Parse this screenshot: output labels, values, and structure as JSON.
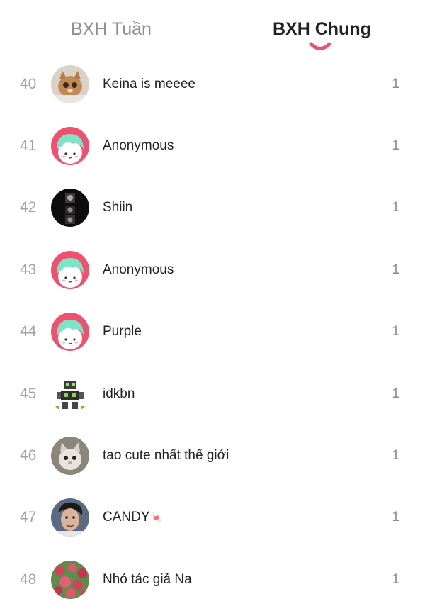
{
  "tabs": {
    "weekly": "BXH Tuần",
    "overall": "BXH Chung",
    "active": "overall"
  },
  "colors": {
    "accent": "#f0506e",
    "anon_bg": "#f0506e",
    "anon_hair": "#7de3c6"
  },
  "rows": [
    {
      "rank": "40",
      "name": "Keina is meeee",
      "score": "1",
      "avatar": "cat-photo"
    },
    {
      "rank": "41",
      "name": "Anonymous",
      "score": "1",
      "avatar": "anonymous-avatar"
    },
    {
      "rank": "42",
      "name": "Shiin",
      "score": "1",
      "avatar": "dark-photo"
    },
    {
      "rank": "43",
      "name": "Anonymous",
      "score": "1",
      "avatar": "anonymous-avatar"
    },
    {
      "rank": "44",
      "name": "Purple",
      "score": "1",
      "avatar": "anonymous-avatar"
    },
    {
      "rank": "45",
      "name": "idkbn",
      "score": "1",
      "avatar": "pixel-robot"
    },
    {
      "rank": "46",
      "name": "tao cute nhất thế giới",
      "score": "1",
      "avatar": "cat-photo-2"
    },
    {
      "rank": "47",
      "name": "CANDY",
      "name_suffix_icon": "candy-icon",
      "score": "1",
      "avatar": "person-photo"
    },
    {
      "rank": "48",
      "name": "Nhỏ tác giả Na",
      "score": "1",
      "avatar": "flowers-photo"
    }
  ]
}
